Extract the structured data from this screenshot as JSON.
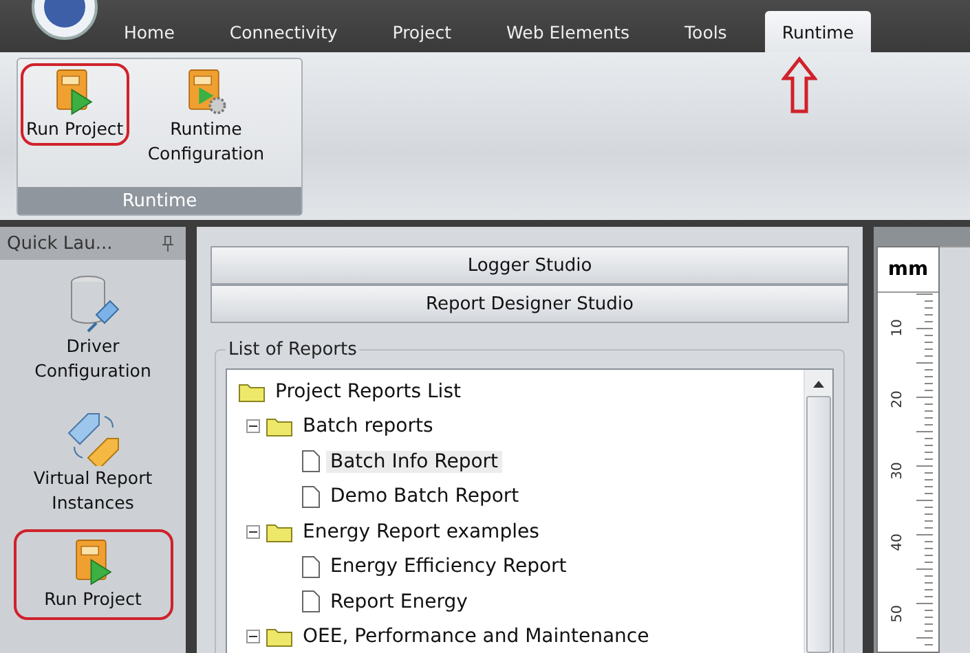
{
  "tabs": [
    {
      "label": "Home",
      "selected": false,
      "marked": false
    },
    {
      "label": "Connectivity",
      "selected": false,
      "marked": false
    },
    {
      "label": "Project",
      "selected": false,
      "marked": false
    },
    {
      "label": "Web Elements",
      "selected": false,
      "marked": false
    },
    {
      "label": "Tools",
      "selected": false,
      "marked": false
    },
    {
      "label": "Runtime",
      "selected": true,
      "marked": true
    }
  ],
  "ribbon_group": {
    "label": "Runtime",
    "buttons": [
      {
        "label": "Run Project",
        "kind": "run",
        "highlighted": true
      },
      {
        "label": "Runtime Configuration",
        "kind": "config",
        "highlighted": false
      }
    ]
  },
  "quick_launch": {
    "title": "Quick Lau...",
    "items": [
      {
        "label": "Driver Configuration",
        "kind": "driver",
        "highlighted": false
      },
      {
        "label": "Virtual Report Instances",
        "kind": "tags",
        "highlighted": false
      },
      {
        "label": "Run Project",
        "kind": "run",
        "highlighted": true
      }
    ]
  },
  "studio_bars": [
    "Logger Studio",
    "Report Designer Studio"
  ],
  "reports": {
    "title": "List of Reports",
    "tree": [
      {
        "label": "Project Reports List",
        "kind": "folder",
        "selected": false,
        "children": [
          {
            "label": "Batch reports",
            "kind": "folder",
            "expanded": true,
            "selected": false,
            "children": [
              {
                "label": "Batch Info Report",
                "kind": "document",
                "selected": true
              },
              {
                "label": "Demo Batch Report",
                "kind": "document",
                "selected": false
              }
            ]
          },
          {
            "label": "Energy Report examples",
            "kind": "folder",
            "expanded": true,
            "selected": false,
            "children": [
              {
                "label": "Energy Efficiency Report",
                "kind": "document",
                "selected": false
              },
              {
                "label": "Report Energy",
                "kind": "document",
                "selected": false
              }
            ]
          },
          {
            "label": "OEE, Performance and Maintenance",
            "kind": "folder",
            "expanded": true,
            "selected": false
          }
        ]
      }
    ]
  },
  "ruler": {
    "unit": "mm",
    "labels": [
      "10",
      "20",
      "30",
      "40",
      "50"
    ]
  }
}
